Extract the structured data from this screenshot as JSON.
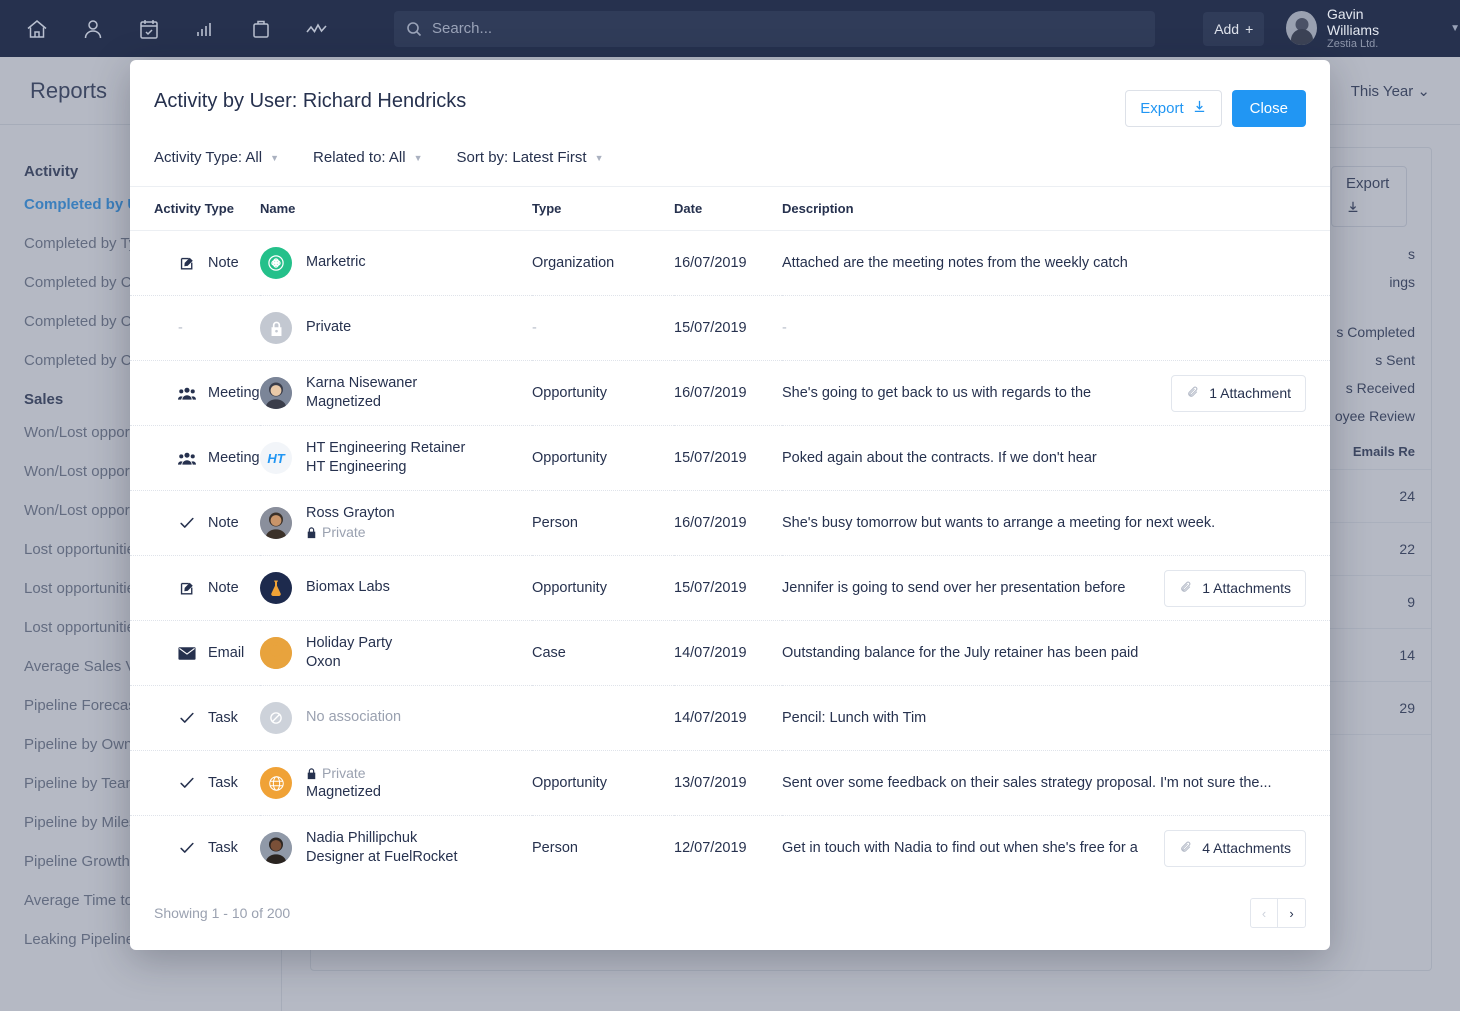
{
  "topnav": {
    "icons": [
      "home-icon",
      "person-icon",
      "calendar-icon",
      "chart-bars-icon",
      "briefcase-icon",
      "trend-line-icon"
    ],
    "search_placeholder": "Search...",
    "search_value": "",
    "add_label": "Add",
    "user": {
      "name": "Gavin Williams",
      "org": "Zestia Ltd."
    }
  },
  "background": {
    "page_title": "Reports",
    "period_label": "This Year",
    "export_label": "Export",
    "sections": [
      {
        "title": "Activity",
        "items": [
          "Completed by User",
          "Completed by Type",
          "Completed by Ce",
          "Completed by Op",
          "Completed by Ca"
        ]
      },
      {
        "title": "Sales",
        "items": [
          "Won/Lost opport",
          "Won/Lost opport",
          "Won/Lost opport",
          "Lost opportunitie",
          "Lost opportunitie",
          "Lost opportunitie",
          "Average Sales Va",
          "Pipeline Forecas",
          "Pipeline by Owne",
          "Pipeline by Team",
          "Pipeline by Miles",
          "Pipeline Growth",
          "Average Time to",
          "Leaking Pipeline"
        ]
      }
    ],
    "fragments": [
      "s",
      "ings",
      "s Completed",
      "s Sent",
      "s Received",
      "oyee Review"
    ],
    "table": {
      "header": "Emails Re",
      "values": [
        "24",
        "22",
        "9",
        "14",
        "29"
      ]
    }
  },
  "modal": {
    "title": "Activity by User: Richard Hendricks",
    "export_label": "Export",
    "close_label": "Close",
    "filters": [
      {
        "label": "Activity Type: All"
      },
      {
        "label": "Related to: All"
      },
      {
        "label": "Sort by: Latest First"
      }
    ],
    "columns": [
      "Activity Type",
      "Name",
      "Type",
      "Date",
      "Description"
    ],
    "rows": [
      {
        "activity": "Note",
        "activity_icon": "note-pencil-icon",
        "avatar": {
          "kind": "logo-marketric",
          "color": "#24c08a"
        },
        "name_line1": "Marketric",
        "name_line2": "",
        "private": false,
        "type": "Organization",
        "date": "16/07/2019",
        "description": "Attached are the meeting notes from the weekly catch",
        "attachment": ""
      },
      {
        "activity": "-",
        "activity_icon": "",
        "avatar": {
          "kind": "lock",
          "color": "#c3c8d1"
        },
        "name_line1": "Private",
        "name_line2": "",
        "private": false,
        "type": "-",
        "date": "15/07/2019",
        "description": "-",
        "attachment": ""
      },
      {
        "activity": "Meeting",
        "activity_icon": "people-group-icon",
        "avatar": {
          "kind": "photo-karna",
          "color": "#7b8598"
        },
        "name_line1": "Karna Nisewaner",
        "name_line2": "Magnetized",
        "private": false,
        "type": "Opportunity",
        "date": "16/07/2019",
        "description": "She's going to get back to us with regards to the",
        "attachment": "1 Attachment"
      },
      {
        "activity": "Meeting",
        "activity_icon": "people-group-icon",
        "avatar": {
          "kind": "logo-ht",
          "color": "#f2f5f9"
        },
        "name_line1": "HT Engineering Retainer",
        "name_line2": "HT Engineering",
        "private": false,
        "type": "Opportunity",
        "date": "15/07/2019",
        "description": "Poked again about the contracts. If we don't hear",
        "attachment": ""
      },
      {
        "activity": "Note",
        "activity_icon": "check-icon",
        "avatar": {
          "kind": "photo-ross",
          "color": "#8a8f9c"
        },
        "name_line1": "Ross Grayton",
        "name_line2": "Private",
        "private": true,
        "type": "Person",
        "date": "16/07/2019",
        "description": "She's busy tomorrow but wants to arrange a meeting for next week.",
        "attachment": ""
      },
      {
        "activity": "Note",
        "activity_icon": "note-pencil-icon",
        "avatar": {
          "kind": "logo-biomax",
          "color": "#1d2a4d"
        },
        "name_line1": "Biomax Labs",
        "name_line2": "",
        "private": false,
        "type": "Opportunity",
        "date": "15/07/2019",
        "description": "Jennifer is going to send over her presentation before",
        "attachment": "1 Attachments"
      },
      {
        "activity": "Email",
        "activity_icon": "envelope-icon",
        "avatar": {
          "kind": "photo-holiday",
          "color": "#e8a33d"
        },
        "name_line1": "Holiday Party",
        "name_line2": "Oxon",
        "private": false,
        "type": "Case",
        "date": "14/07/2019",
        "description": "Outstanding balance for the July retainer has been paid",
        "attachment": ""
      },
      {
        "activity": "Task",
        "activity_icon": "check-icon",
        "avatar": {
          "kind": "no-association",
          "color": "#cdd2da"
        },
        "name_line1": "No association",
        "name_line2": "",
        "private": false,
        "type": "",
        "date": "14/07/2019",
        "description": "Pencil: Lunch with Tim",
        "attachment": ""
      },
      {
        "activity": "Task",
        "activity_icon": "check-icon",
        "avatar": {
          "kind": "logo-globe",
          "color": "#f0a236"
        },
        "name_line1": "Private",
        "name_line2": "Magnetized",
        "private": true,
        "type": "Opportunity",
        "date": "13/07/2019",
        "description": "Sent over some feedback on their sales strategy proposal. I'm not sure the...",
        "attachment": ""
      },
      {
        "activity": "Task",
        "activity_icon": "check-icon",
        "avatar": {
          "kind": "photo-nadia",
          "color": "#9099a8"
        },
        "name_line1": "Nadia Phillipchuk",
        "name_line2": "Designer at FuelRocket",
        "private": false,
        "type": "Person",
        "date": "12/07/2019",
        "description": "Get in touch with Nadia to find out when she's free for a",
        "attachment": "4 Attachments"
      }
    ],
    "footer": {
      "showing": "Showing 1 - 10 of 200",
      "prev_label": "‹",
      "next_label": "›"
    }
  },
  "colors": {
    "nav_bg": "#26314e",
    "accent": "#2196f3",
    "text": "#26314e",
    "muted": "#9aa1b0"
  }
}
